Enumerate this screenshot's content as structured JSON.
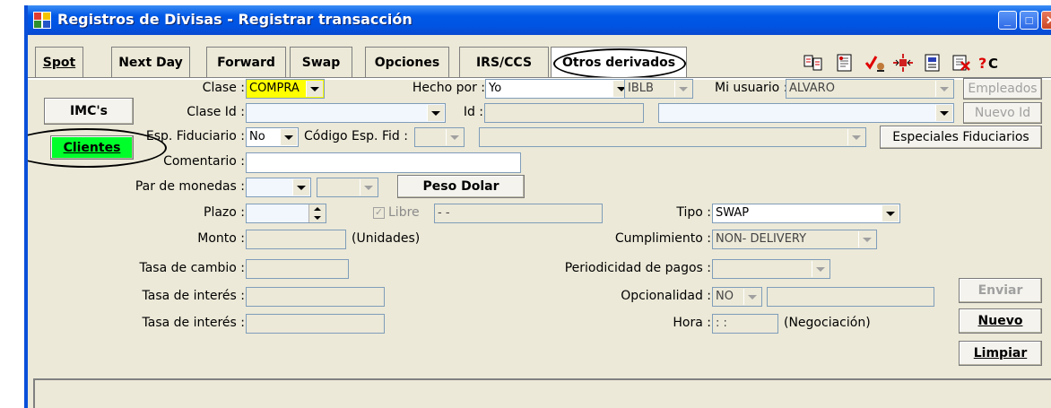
{
  "window": {
    "title": "Registros de Divisas - Registrar transacción"
  },
  "tabs": [
    {
      "label": "Spot"
    },
    {
      "label": "Next Day"
    },
    {
      "label": "Forward"
    },
    {
      "label": "Swap"
    },
    {
      "label": "Opciones"
    },
    {
      "label": "IRS/CCS"
    },
    {
      "label": "Otros derivados"
    }
  ],
  "toolbar_icons": [
    "compare-icon",
    "document-icon",
    "check-user-icon",
    "merge-icon",
    "report-icon",
    "delete-doc-icon",
    "help-icon"
  ],
  "left_buttons": {
    "imc": "IMC's",
    "clientes": "Clientes"
  },
  "form": {
    "clase": {
      "label": "Clase :",
      "value": "COMPRA"
    },
    "hecho_por": {
      "label": "Hecho por :",
      "value": "Yo"
    },
    "hecho_por_code": {
      "value": "IBLB"
    },
    "mi_usuario": {
      "label": "Mi usuario :",
      "value": "ALVARO"
    },
    "empleados_button": "Empleados",
    "clase_id": {
      "label": "Clase Id :",
      "value": ""
    },
    "id": {
      "label": "Id :",
      "value": ""
    },
    "nuevo_id_button": "Nuevo Id",
    "esp_fiduciario": {
      "label": "Esp. Fiduciario :",
      "value": "No"
    },
    "codigo_esp_fid": {
      "label": "Código Esp. Fid :",
      "value": ""
    },
    "especiales_fiduciarios_button": "Especiales Fiduciarios",
    "comentario": {
      "label": "Comentario :",
      "value": ""
    },
    "par_monedas": {
      "label": "Par de monedas :"
    },
    "peso_dolar_button": "Peso Dolar",
    "plazo": {
      "label": "Plazo :",
      "value": ""
    },
    "libre": {
      "label": "Libre",
      "value": "- -",
      "checked": true
    },
    "tipo": {
      "label": "Tipo :",
      "value": "SWAP"
    },
    "monto": {
      "label": "Monto :",
      "unit": "(Unidades)"
    },
    "cumplimiento": {
      "label": "Cumplimiento :",
      "value": "NON- DELIVERY"
    },
    "tasa_cambio": {
      "label": "Tasa de cambio :"
    },
    "periodicidad": {
      "label": "Periodicidad de pagos :",
      "value": ""
    },
    "tasa_interes_1": {
      "label": "Tasa de interés :"
    },
    "opcionalidad": {
      "label": "Opcionalidad :",
      "value": "NO"
    },
    "tasa_interes_2": {
      "label": "Tasa de interés :"
    },
    "hora": {
      "label": "Hora :",
      "value": ": :",
      "note": "(Negociación)"
    }
  },
  "actions": {
    "enviar": "Enviar",
    "nuevo": "Nuevo",
    "limpiar": "Limpiar"
  },
  "colors": {
    "title_bar": "#0054e3",
    "clientes_button": "#00ff2a",
    "clase_field": "#ffff00",
    "window_bg": "#ece9d8"
  }
}
